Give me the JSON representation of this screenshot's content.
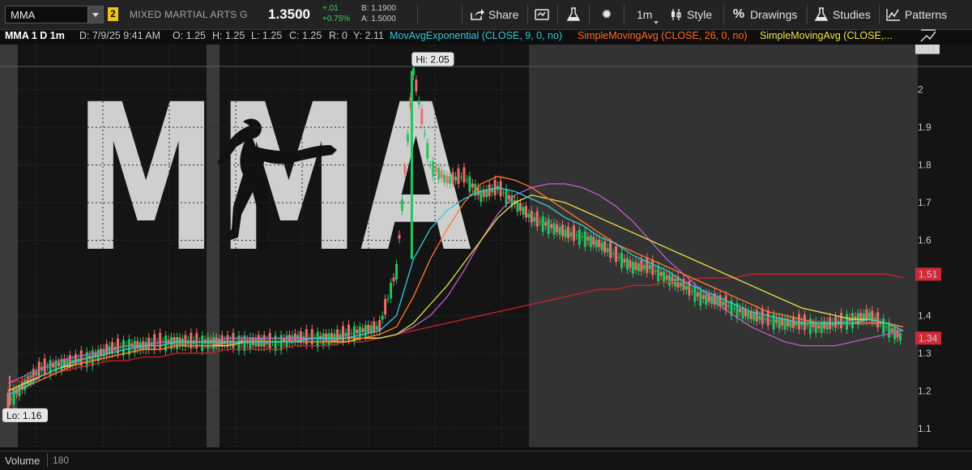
{
  "toolbar": {
    "symbol": "MMA",
    "link_group": "2",
    "company": "MIXED MARTIAL ARTS G",
    "last_price": "1.3500",
    "net_change": "+.01",
    "pct_change": "+0.75%",
    "bid": "B: 1.1900",
    "ask": "A: 1.5000",
    "share_label": "Share",
    "timeframe_label": "1m",
    "style_label": "Style",
    "drawings_label": "Drawings",
    "studies_label": "Studies",
    "patterns_label": "Patterns"
  },
  "info_bar": {
    "title": "MMA 1 D 1m",
    "date": "D: 7/9/25 9:41 AM",
    "open": "O: 1.25",
    "high": "H: 1.25",
    "low": "L: 1.25",
    "close": "C: 1.25",
    "range": "R: 0",
    "y": "Y: 2.11",
    "study_ema": "MovAvgExponential (CLOSE, 9, 0, no)",
    "study_sma26": "SimpleMovingAvg (CLOSE, 26, 0, no)",
    "study_sma_other": "SimpleMovingAvg (CLOSE,..."
  },
  "chart_data": {
    "type": "line",
    "price_axis_ticks": [
      2.11,
      2,
      1.9,
      1.8,
      1.7,
      1.6,
      1.51,
      1.4,
      1.34,
      1.3,
      1.2,
      1.1
    ],
    "ylim": [
      1.05,
      2.12
    ],
    "hi_label": "Hi: 2.05",
    "lo_label": "Lo: 1.16",
    "hi_value": 2.05,
    "lo_value": 1.16,
    "current_price_label": "1.34",
    "sma_red_label": "1.51",
    "logo_text": "MMA",
    "colors": {
      "up": "#22c55e",
      "down": "#f26b6b",
      "ema9": "#38c9d8",
      "sma26": "#ff7a2a",
      "sma_yellow": "#e8e04a",
      "sma_red": "#d0202c",
      "sma_magenta": "#c060c8",
      "extended_hours": "#3a3a3a"
    },
    "series": [
      {
        "name": "price",
        "values": [
          1.17,
          1.22,
          1.26,
          1.27,
          1.28,
          1.29,
          1.31,
          1.32,
          1.32,
          1.33,
          1.33,
          1.33,
          1.33,
          1.33,
          1.33,
          1.33,
          1.33,
          1.34,
          1.34,
          1.34,
          1.35,
          1.36,
          1.37,
          1.52,
          2.05,
          1.8,
          1.76,
          1.77,
          1.72,
          1.74,
          1.7,
          1.66,
          1.64,
          1.62,
          1.61,
          1.59,
          1.56,
          1.53,
          1.53,
          1.5,
          1.48,
          1.45,
          1.44,
          1.42,
          1.4,
          1.39,
          1.38,
          1.38,
          1.37,
          1.38,
          1.39,
          1.4,
          1.37,
          1.34
        ]
      },
      {
        "name": "MovAvgExponential (CLOSE, 9, 0, no)",
        "values": [
          1.19,
          1.21,
          1.24,
          1.26,
          1.28,
          1.29,
          1.3,
          1.31,
          1.32,
          1.32,
          1.33,
          1.33,
          1.33,
          1.33,
          1.33,
          1.33,
          1.33,
          1.33,
          1.34,
          1.34,
          1.34,
          1.35,
          1.36,
          1.4,
          1.55,
          1.63,
          1.68,
          1.71,
          1.73,
          1.74,
          1.73,
          1.71,
          1.69,
          1.66,
          1.64,
          1.61,
          1.59,
          1.56,
          1.54,
          1.52,
          1.49,
          1.47,
          1.45,
          1.43,
          1.41,
          1.4,
          1.39,
          1.38,
          1.38,
          1.38,
          1.38,
          1.39,
          1.38,
          1.36
        ]
      },
      {
        "name": "SimpleMovingAvg (CLOSE, 26, 0, no)",
        "values": [
          1.2,
          1.21,
          1.23,
          1.25,
          1.27,
          1.28,
          1.29,
          1.3,
          1.31,
          1.31,
          1.32,
          1.32,
          1.32,
          1.33,
          1.33,
          1.33,
          1.33,
          1.33,
          1.33,
          1.33,
          1.34,
          1.34,
          1.35,
          1.37,
          1.45,
          1.55,
          1.63,
          1.7,
          1.75,
          1.77,
          1.76,
          1.74,
          1.71,
          1.68,
          1.65,
          1.62,
          1.59,
          1.57,
          1.55,
          1.53,
          1.51,
          1.49,
          1.47,
          1.45,
          1.43,
          1.41,
          1.4,
          1.39,
          1.38,
          1.38,
          1.38,
          1.38,
          1.38,
          1.37
        ]
      },
      {
        "name": "SimpleMovingAvg (CLOSE,...",
        "values": [
          1.2,
          1.22,
          1.24,
          1.26,
          1.27,
          1.28,
          1.29,
          1.3,
          1.31,
          1.31,
          1.32,
          1.32,
          1.32,
          1.32,
          1.33,
          1.33,
          1.33,
          1.33,
          1.33,
          1.33,
          1.33,
          1.34,
          1.34,
          1.35,
          1.38,
          1.43,
          1.48,
          1.54,
          1.6,
          1.66,
          1.7,
          1.72,
          1.71,
          1.7,
          1.68,
          1.66,
          1.64,
          1.62,
          1.6,
          1.58,
          1.56,
          1.54,
          1.52,
          1.5,
          1.48,
          1.46,
          1.44,
          1.42,
          1.41,
          1.4,
          1.39,
          1.39,
          1.38,
          1.37
        ]
      }
    ],
    "series_extra": [
      {
        "values": [
          1.22,
          1.23,
          1.24,
          1.25,
          1.26,
          1.27,
          1.28,
          1.28,
          1.29,
          1.29,
          1.3,
          1.3,
          1.3,
          1.31,
          1.31,
          1.31,
          1.31,
          1.32,
          1.32,
          1.32,
          1.33,
          1.33,
          1.34,
          1.35,
          1.36,
          1.37,
          1.38,
          1.39,
          1.4,
          1.41,
          1.42,
          1.43,
          1.44,
          1.45,
          1.46,
          1.47,
          1.47,
          1.48,
          1.48,
          1.49,
          1.49,
          1.5,
          1.5,
          1.5,
          1.51,
          1.51,
          1.51,
          1.51,
          1.51,
          1.51,
          1.51,
          1.51,
          1.51,
          1.5
        ]
      },
      {
        "values": [
          1.22,
          1.24,
          1.26,
          1.28,
          1.29,
          1.3,
          1.31,
          1.32,
          1.32,
          1.33,
          1.33,
          1.33,
          1.33,
          1.34,
          1.34,
          1.34,
          1.34,
          1.34,
          1.34,
          1.34,
          1.34,
          1.34,
          1.34,
          1.35,
          1.37,
          1.4,
          1.45,
          1.52,
          1.6,
          1.67,
          1.72,
          1.74,
          1.75,
          1.75,
          1.74,
          1.72,
          1.69,
          1.65,
          1.6,
          1.55,
          1.51,
          1.47,
          1.43,
          1.4,
          1.37,
          1.35,
          1.33,
          1.32,
          1.32,
          1.32,
          1.33,
          1.34,
          1.35,
          1.36
        ]
      }
    ]
  },
  "volume": {
    "label": "Volume",
    "value": "180"
  }
}
